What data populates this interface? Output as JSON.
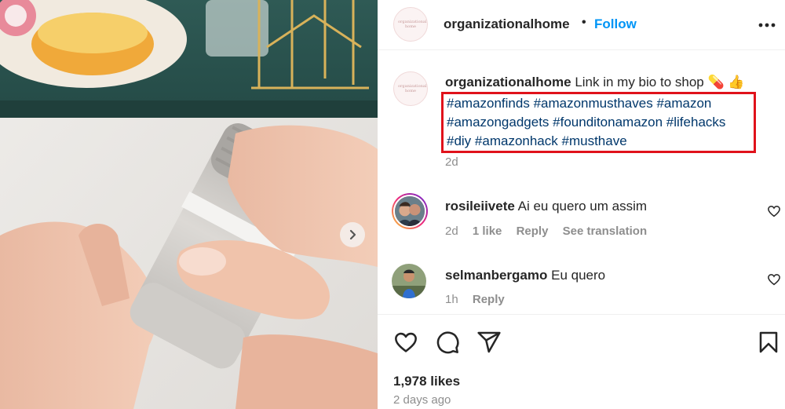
{
  "post": {
    "username": "organizationalhome",
    "avatar_logo_text": "organizational home",
    "separator": "•",
    "follow_label": "Follow",
    "more_icon": "more-horizontal-icon"
  },
  "caption": {
    "username": "organizationalhome",
    "text": "Link in my bio to shop",
    "emoji": "💊 👍",
    "hashtag_lines": [
      [
        "#amazonfinds",
        "#amazonmusthaves",
        "#amazon"
      ],
      [
        "#amazongadgets",
        "#founditonamazon",
        "#lifehacks"
      ],
      [
        "#diy",
        "#amazonhack",
        "#musthave"
      ]
    ],
    "time": "2d",
    "highlight_color": "#e0121b"
  },
  "comments": [
    {
      "username": "rosileiivete",
      "text": "Ai eu quero um assim",
      "time": "2d",
      "likes": "1 like",
      "reply": "Reply",
      "translate": "See translation"
    },
    {
      "username": "selmanbergamo",
      "text": "Eu quero",
      "time": "1h",
      "reply": "Reply"
    }
  ],
  "actions": {
    "icons": [
      "heart-icon",
      "comment-icon",
      "share-icon",
      "bookmark-icon"
    ],
    "likes": "1,978 likes",
    "date": "2 days ago"
  },
  "media": {
    "next_icon": "chevron-right-icon"
  },
  "colors": {
    "link": "#00376b",
    "follow": "#0095f6",
    "muted": "#8e8e8e"
  }
}
